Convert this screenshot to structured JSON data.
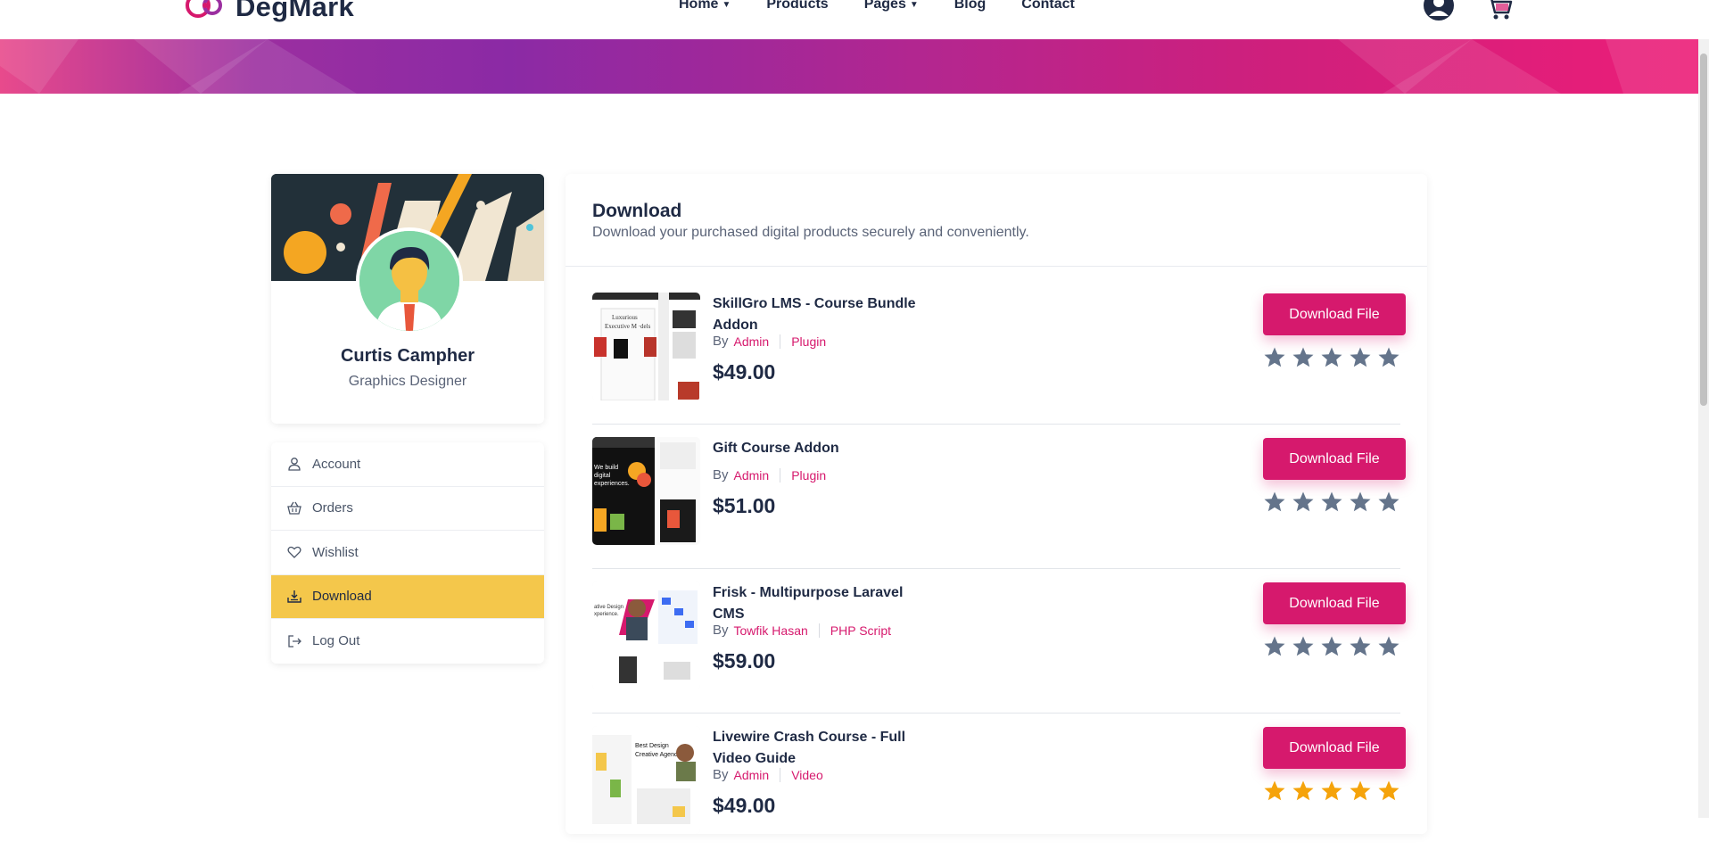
{
  "header": {
    "brand": "DegMark",
    "nav": [
      {
        "label": "Home",
        "dropdown": true
      },
      {
        "label": "Products",
        "dropdown": false
      },
      {
        "label": "Pages",
        "dropdown": true
      },
      {
        "label": "Blog",
        "dropdown": false
      },
      {
        "label": "Contact",
        "dropdown": false
      }
    ],
    "icons": [
      "user-icon",
      "cart-icon"
    ]
  },
  "profile": {
    "name": "Curtis Campher",
    "role": "Graphics Designer"
  },
  "menu": [
    {
      "label": "Account",
      "icon": "user-icon",
      "active": false
    },
    {
      "label": "Orders",
      "icon": "basket-icon",
      "active": false
    },
    {
      "label": "Wishlist",
      "icon": "heart-icon",
      "active": false
    },
    {
      "label": "Download",
      "icon": "download-icon",
      "active": true
    },
    {
      "label": "Log Out",
      "icon": "logout-icon",
      "active": false
    }
  ],
  "download": {
    "title": "Download",
    "subtitle": "Download your purchased digital products securely and conveniently.",
    "button_label": "Download File",
    "by_label": "By",
    "products": [
      {
        "title": "SkillGro LMS - Course Bundle Addon",
        "author": "Admin",
        "category": "Plugin",
        "price": "$49.00",
        "rating": 0
      },
      {
        "title": "Gift Course Addon",
        "author": "Admin",
        "category": "Plugin",
        "price": "$51.00",
        "rating": 0
      },
      {
        "title": "Frisk - Multipurpose Laravel CMS",
        "author": "Towfik Hasan",
        "category": "PHP Script",
        "price": "$59.00",
        "rating": 0
      },
      {
        "title": "Livewire Crash Course - Full Video Guide",
        "author": "Admin",
        "category": "Video",
        "price": "$49.00",
        "rating": 5
      }
    ]
  },
  "colors": {
    "accent": "#d6196d",
    "active_menu": "#f4c74b",
    "text_dark": "#1f2a44",
    "star_empty": "#64748b",
    "star_filled": "#f5a30b"
  }
}
